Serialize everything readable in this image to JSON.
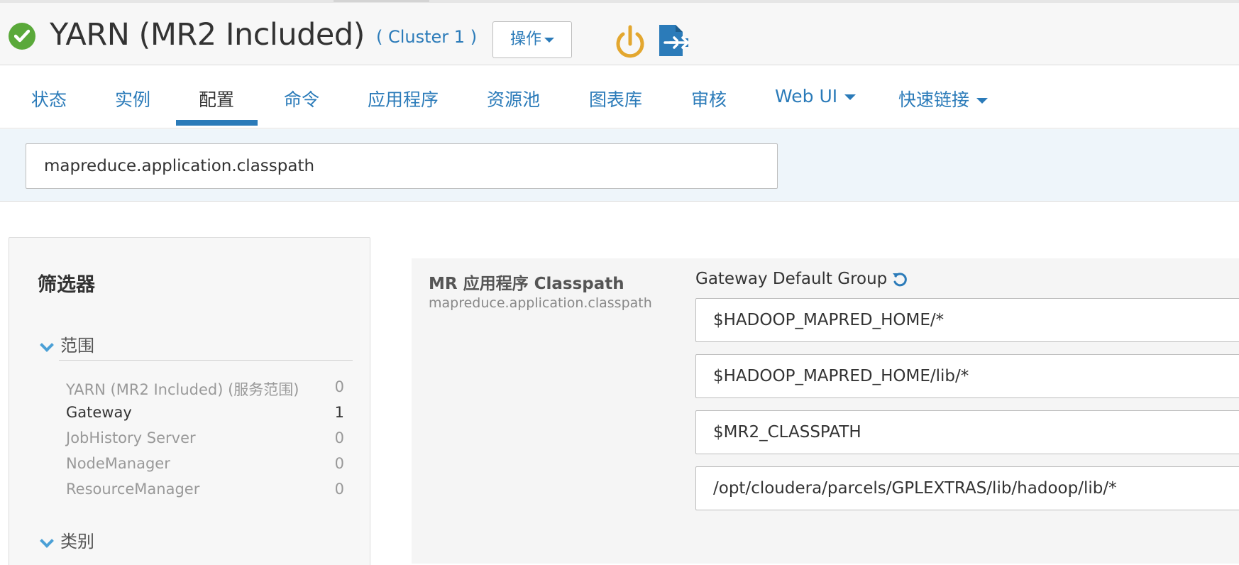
{
  "header": {
    "service_title": "YARN (MR2 Included)",
    "cluster_link": "( Cluster 1 )",
    "actions_label": "操作",
    "status_icon": "check-circle-icon",
    "status_color": "#5aa93a",
    "power_icon_color": "#e3a72f",
    "export_icon_color": "#2b7bb9"
  },
  "nav": {
    "tabs": [
      {
        "label": "状态"
      },
      {
        "label": "实例"
      },
      {
        "label": "配置",
        "active": true
      },
      {
        "label": "命令"
      },
      {
        "label": "应用程序"
      },
      {
        "label": "资源池"
      },
      {
        "label": "图表库"
      },
      {
        "label": "审核"
      },
      {
        "label": "Web UI",
        "dropdown": true
      },
      {
        "label": "快速链接",
        "dropdown": true
      }
    ],
    "accent_color": "#2b7bb9"
  },
  "search": {
    "value": "mapreduce.application.classpath"
  },
  "filters": {
    "title": "筛选器",
    "sections": [
      {
        "label": "范围",
        "expanded": true,
        "items": [
          {
            "label": "YARN (MR2 Included) (服务范围)",
            "count": "0"
          },
          {
            "label": "Gateway",
            "count": "1",
            "selected": true
          },
          {
            "label": "JobHistory Server",
            "count": "0"
          },
          {
            "label": "NodeManager",
            "count": "0"
          },
          {
            "label": "ResourceManager",
            "count": "0"
          }
        ]
      },
      {
        "label": "类别",
        "expanded": true
      }
    ]
  },
  "config": {
    "property_display_name": "MR 应用程序 Classpath",
    "property_key": "mapreduce.application.classpath",
    "group_label": "Gateway Default Group",
    "values": [
      "$HADOOP_MAPRED_HOME/*",
      "$HADOOP_MAPRED_HOME/lib/*",
      "$MR2_CLASSPATH",
      "/opt/cloudera/parcels/GPLEXTRAS/lib/hadoop/lib/*"
    ]
  }
}
